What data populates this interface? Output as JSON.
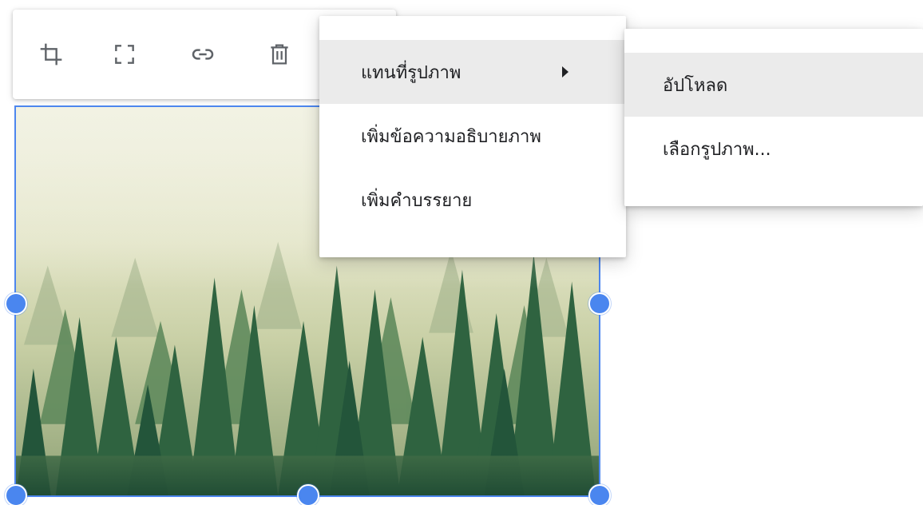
{
  "toolbar": {
    "buttons": [
      {
        "name": "crop",
        "icon": "crop-icon"
      },
      {
        "name": "fullscreen",
        "icon": "fullscreen-icon"
      },
      {
        "name": "link",
        "icon": "link-icon"
      },
      {
        "name": "delete",
        "icon": "trash-icon"
      }
    ]
  },
  "image": {
    "subject": "misty pine forest",
    "selected": true,
    "selection_color": "#4a86ef"
  },
  "context_menu": {
    "items": [
      {
        "label": "แทนที่รูปภาพ",
        "has_submenu": true,
        "active": true
      },
      {
        "label": "เพิ่มข้อความอธิบายภาพ",
        "has_submenu": false
      },
      {
        "label": "เพิ่มคำบรรยาย",
        "has_submenu": false
      }
    ]
  },
  "submenu": {
    "items": [
      {
        "label": "อัปโหลด",
        "active": true
      },
      {
        "label": "เลือกรูปภาพ..."
      }
    ]
  },
  "colors": {
    "accent": "#4a86ef",
    "menu_hover": "#ebebeb",
    "icon": "#5f6368",
    "text": "#202124"
  }
}
